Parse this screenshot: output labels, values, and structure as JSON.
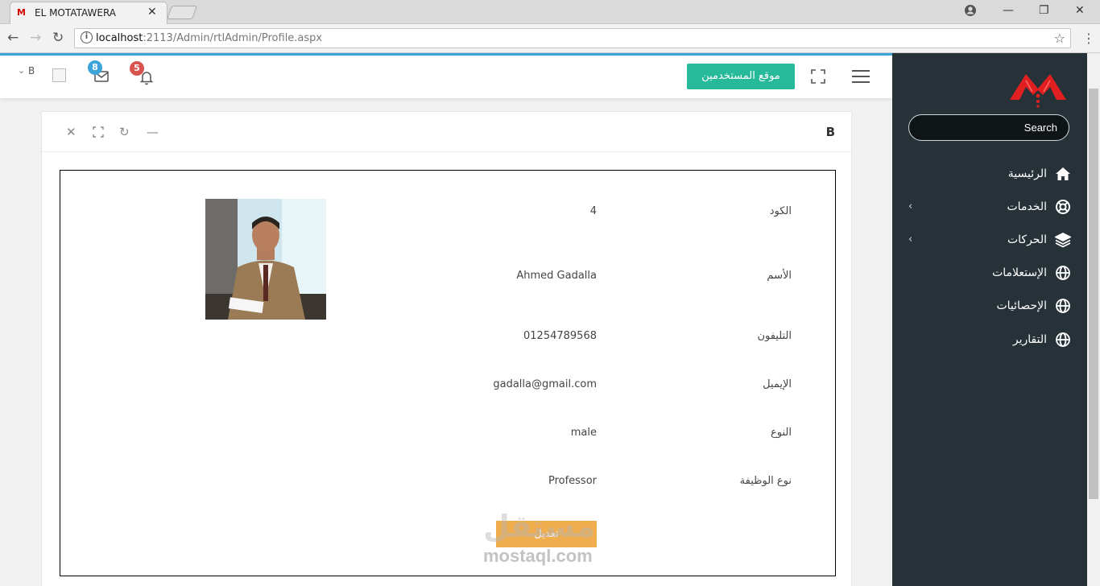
{
  "browser": {
    "tab_title": "EL MOTATAWERA",
    "tab_favicon": "M",
    "url_host": "localhost",
    "url_path": ":2113/Admin/rtlAdmin/Profile.aspx"
  },
  "header": {
    "site_button": "موقع المستخدمين",
    "mail_count": "8",
    "notif_count": "5",
    "user_initial": "B"
  },
  "sidebar": {
    "search_placeholder": "Search",
    "items": [
      {
        "label": "الرئيسية",
        "icon": "home-icon",
        "has_children": false
      },
      {
        "label": "الخدمات",
        "icon": "lifebuoy-icon",
        "has_children": true
      },
      {
        "label": "الحركات",
        "icon": "layers-icon",
        "has_children": true
      },
      {
        "label": "الإستعلامات",
        "icon": "globe-icon",
        "has_children": false
      },
      {
        "label": "الإحصائيات",
        "icon": "globe-icon",
        "has_children": false
      },
      {
        "label": "التقارير",
        "icon": "globe-icon",
        "has_children": false
      }
    ]
  },
  "panel": {
    "title": "B",
    "profile": [
      {
        "label": "الكود",
        "value": "4"
      },
      {
        "label": "الأسم",
        "value": "Ahmed Gadalla"
      },
      {
        "label": "التليفون",
        "value": "01254789568"
      },
      {
        "label": "الإيميل",
        "value": "gadalla@gmail.com"
      },
      {
        "label": "النوع",
        "value": "male"
      },
      {
        "label": "نوع الوظيفة",
        "value": "Professor"
      }
    ],
    "edit_button": "تعديل"
  },
  "watermark": {
    "arabic": "مستقل",
    "latin": "mostaql.com"
  },
  "colors": {
    "sidebar_bg": "#263238",
    "accent_blue": "#3ea3d8",
    "site_button": "#26b99a",
    "edit_button": "#f0ad4e",
    "mail_badge": "#3ea3d8",
    "notif_badge": "#d9534f",
    "logo_red": "#e02020"
  }
}
